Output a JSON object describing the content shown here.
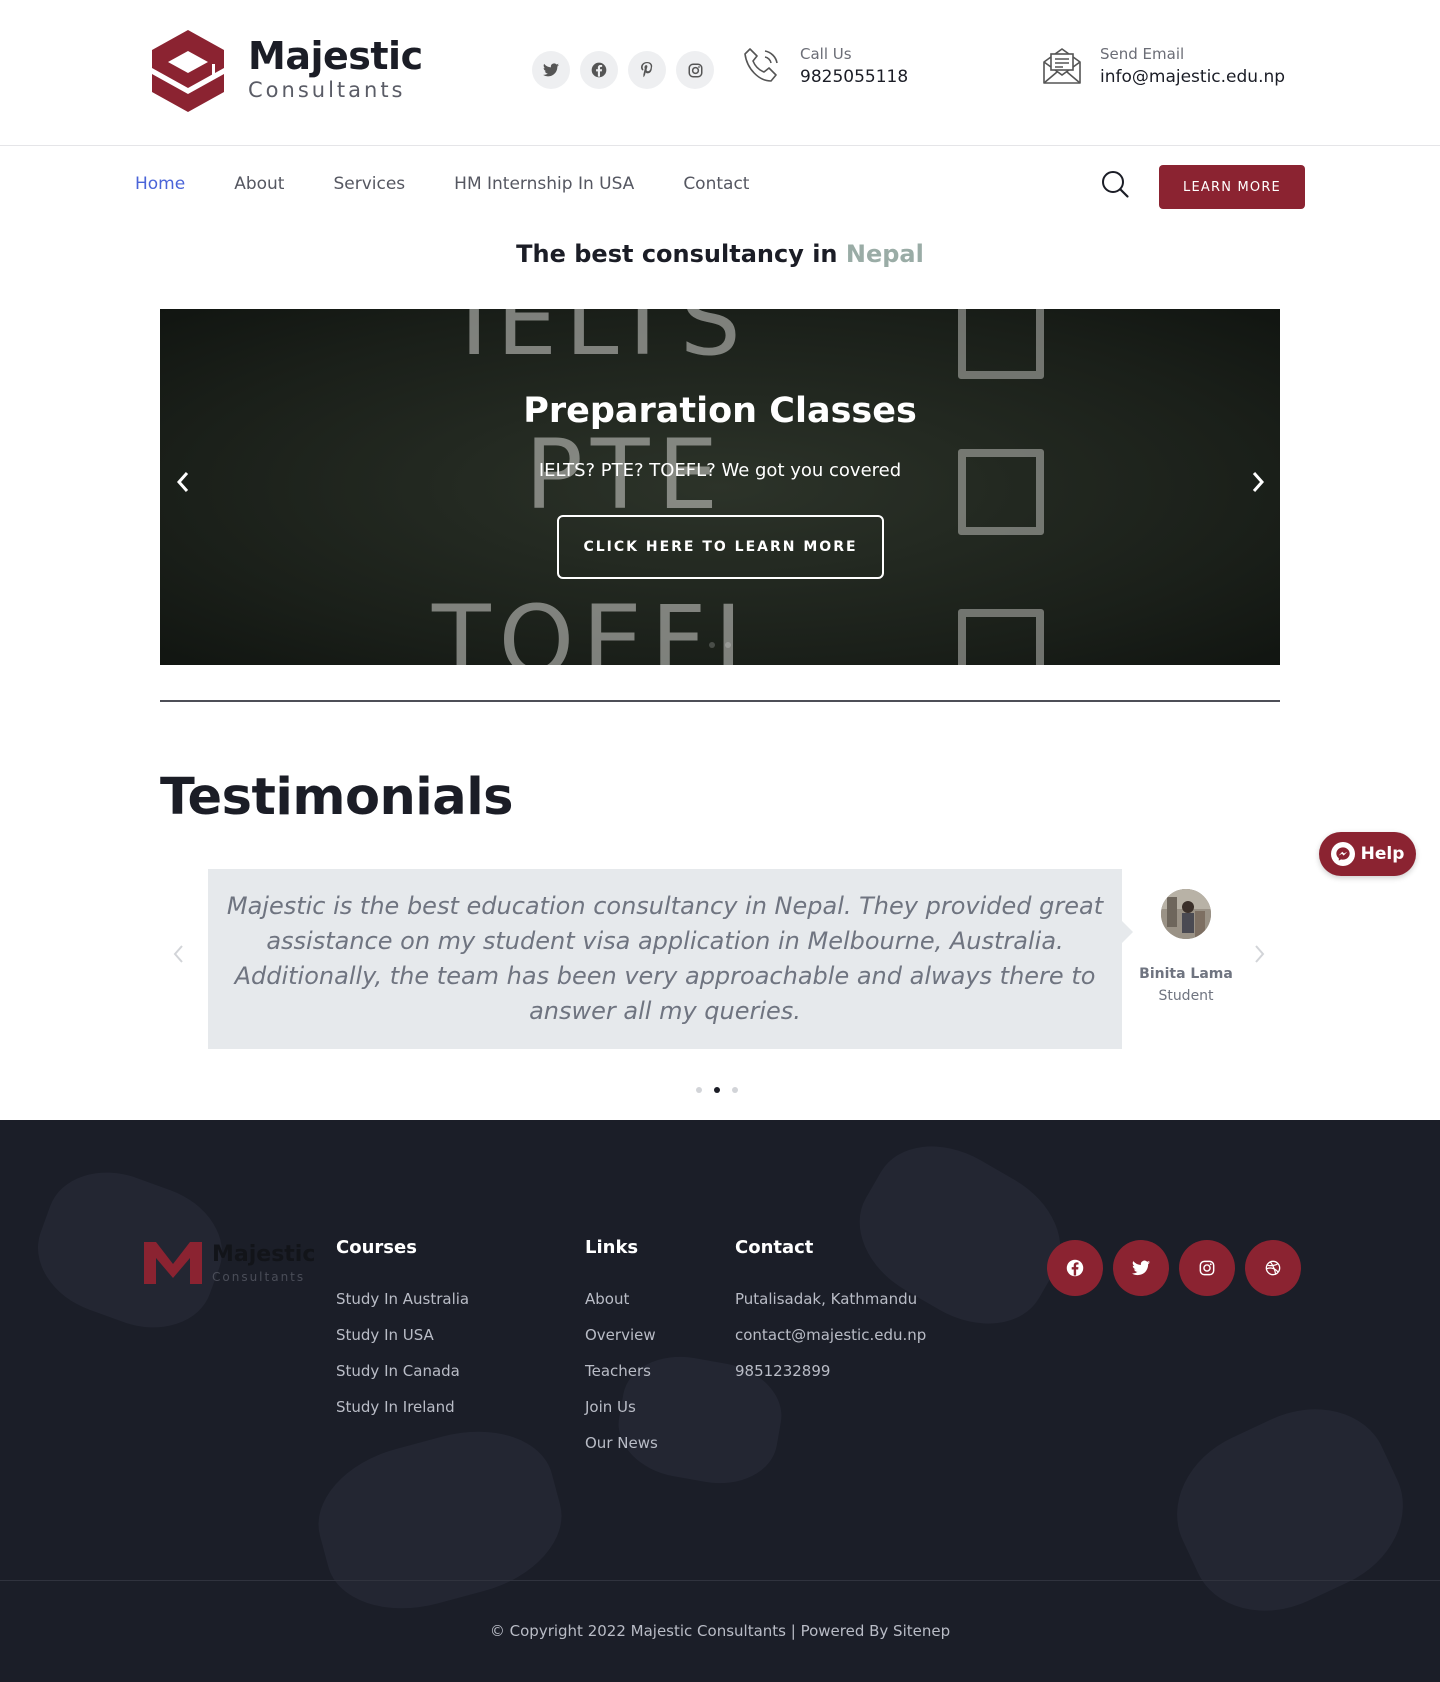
{
  "brand": {
    "name": "Majestic",
    "sub": "Consultants",
    "color": "#8b2331"
  },
  "header": {
    "social_icons": [
      "twitter-icon",
      "facebook-icon",
      "pinterest-icon",
      "instagram-icon"
    ],
    "call_label": "Call Us",
    "call_value": "9825055118",
    "email_label": "Send Email",
    "email_value": "info@majestic.edu.np"
  },
  "nav": {
    "items": [
      {
        "label": "Home",
        "active": true
      },
      {
        "label": "About"
      },
      {
        "label": "Services"
      },
      {
        "label": "HM Internship In USA"
      },
      {
        "label": "Contact"
      }
    ],
    "cta_label": "LEARN MORE",
    "accent": "#4a64d8"
  },
  "tagline": {
    "text": "The best consultancy in",
    "accent": "Nepal"
  },
  "hero": {
    "title": "Preparation Classes",
    "subtitle": "IELTS? PTE? TOEFL? We got you covered",
    "button": "CLICK HERE TO LEARN MORE",
    "board_words": [
      "IELTS",
      "PTE",
      "TOEFL"
    ]
  },
  "testimonials": {
    "title": "Testimonials",
    "quote": "Majestic is the best education consultancy in Nepal. They provided great assistance on my student visa application in Melbourne, Australia. Additionally, the team has been very approachable and always there to answer all my queries.",
    "name": "Binita Lama",
    "role": "Student"
  },
  "help": {
    "label": "Help"
  },
  "footer": {
    "courses_title": "Courses",
    "courses": [
      "Study In Australia",
      "Study In USA",
      "Study In Canada",
      "Study In Ireland"
    ],
    "links_title": "Links",
    "links": [
      "About",
      "Overview",
      "Teachers",
      "Join Us",
      "Our News"
    ],
    "contact_title": "Contact",
    "contact": [
      "Putalisadak, Kathmandu",
      "contact@majestic.edu.np",
      "9851232899"
    ],
    "social_icons": [
      "facebook-icon",
      "twitter-icon",
      "instagram-icon",
      "dribbble-icon"
    ],
    "copyright": "© Copyright 2022 Majestic Consultants | Powered By Sitenep"
  }
}
